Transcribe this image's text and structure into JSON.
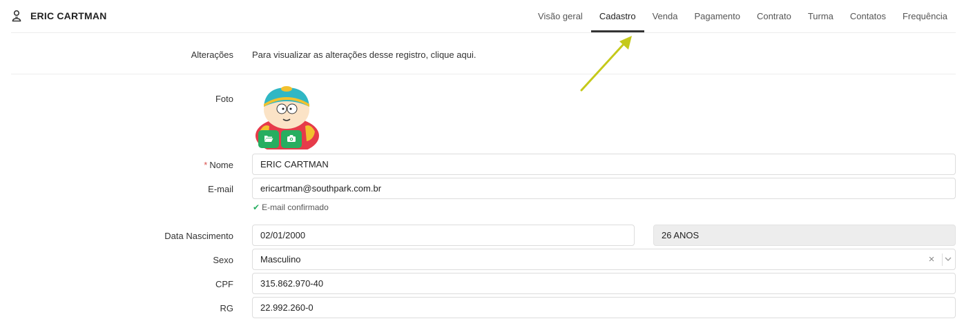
{
  "header": {
    "title": "ERIC CARTMAN",
    "tabs": [
      {
        "label": "Visão geral"
      },
      {
        "label": "Cadastro"
      },
      {
        "label": "Venda"
      },
      {
        "label": "Pagamento"
      },
      {
        "label": "Contrato"
      },
      {
        "label": "Turma"
      },
      {
        "label": "Contatos"
      },
      {
        "label": "Frequência"
      }
    ],
    "active_tab": "Cadastro"
  },
  "changes": {
    "label": "Alterações",
    "text": "Para visualizar as alterações desse registro, clique aqui."
  },
  "photo": {
    "label": "Foto",
    "buttons": [
      "folder-open-icon",
      "camera-icon"
    ]
  },
  "form": {
    "name": {
      "label": "Nome",
      "required_mark": "*",
      "value": "ERIC CARTMAN"
    },
    "email": {
      "label": "E-mail",
      "value": "ericartman@southpark.com.br",
      "status": "E-mail confirmado"
    },
    "birth": {
      "label": "Data Nascimento",
      "value": "02/01/2000",
      "age": "26 ANOS"
    },
    "gender": {
      "label": "Sexo",
      "value": "Masculino",
      "clear": "×"
    },
    "cpf": {
      "label": "CPF",
      "value": "315.862.970-40"
    },
    "rg": {
      "label": "RG",
      "value": "22.992.260-0"
    }
  },
  "colors": {
    "accent_green": "#27ae60",
    "annotation_arrow": "#c5c91a",
    "required": "#d9534f"
  }
}
